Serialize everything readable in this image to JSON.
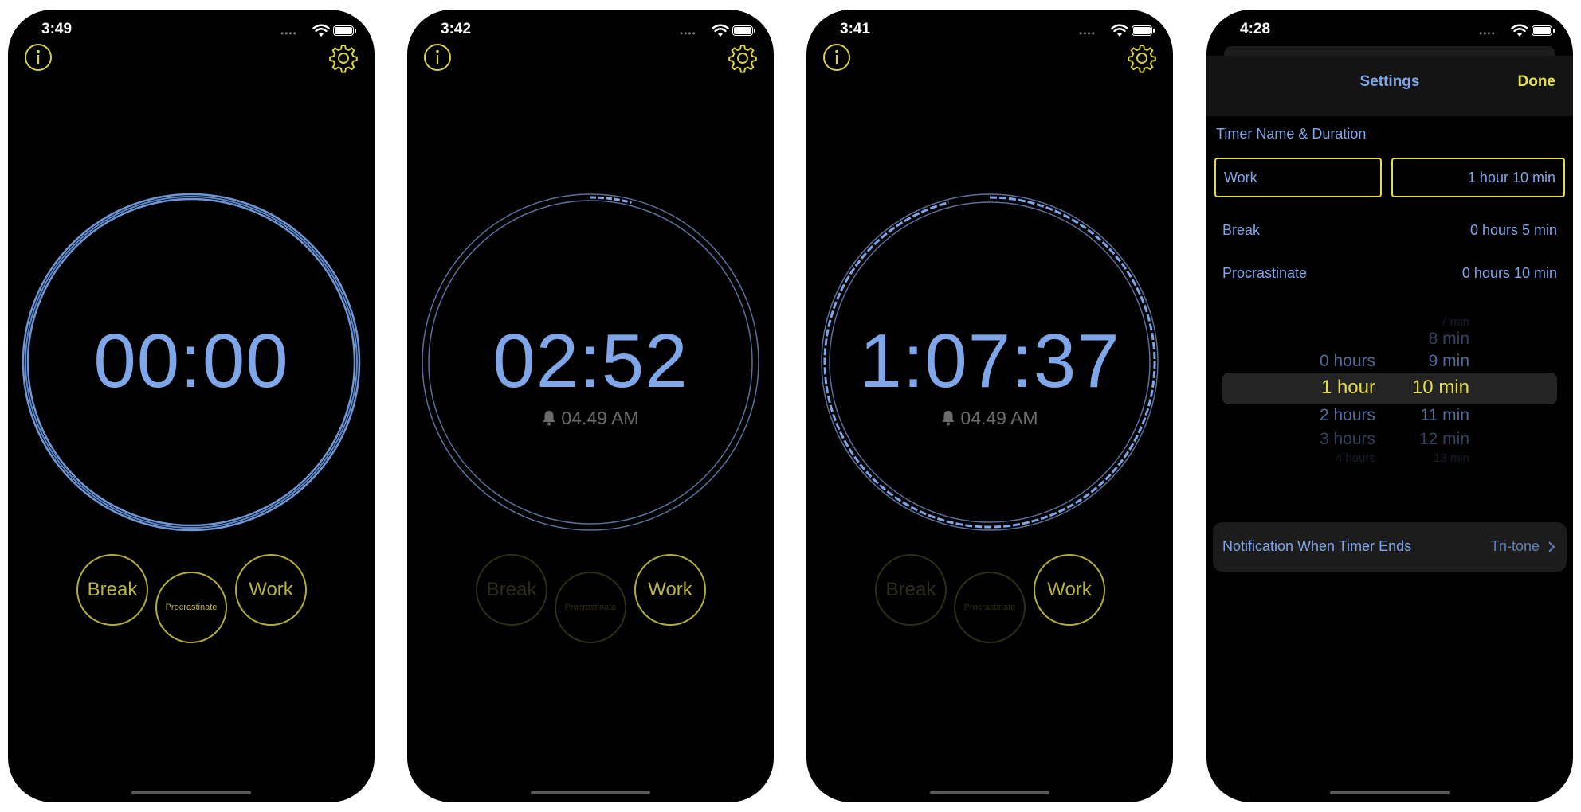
{
  "screens": [
    {
      "status_time": "3:49",
      "timer": "00:00",
      "alarm": "",
      "progress": 0,
      "buttons": {
        "break": "Break",
        "procrastinate": "Procrastinate",
        "work": "Work"
      },
      "button_states": {
        "break": "active",
        "procrastinate": "active",
        "work": "active"
      }
    },
    {
      "status_time": "3:42",
      "timer": "02:52",
      "alarm": "04.49 AM",
      "progress": 0.04,
      "buttons": {
        "break": "Break",
        "procrastinate": "Procrastinate",
        "work": "Work"
      },
      "button_states": {
        "break": "dim",
        "procrastinate": "dim",
        "work": "active"
      }
    },
    {
      "status_time": "3:41",
      "timer": "1:07:37",
      "alarm": "04.49 AM",
      "progress": 0.96,
      "buttons": {
        "break": "Break",
        "procrastinate": "Procrastinate",
        "work": "Work"
      },
      "button_states": {
        "break": "dim",
        "procrastinate": "dim",
        "work": "active"
      }
    }
  ],
  "settings": {
    "status_time": "4:28",
    "title": "Settings",
    "done": "Done",
    "section": "Timer Name & Duration",
    "selected_name": "Work",
    "selected_duration": "1 hour  10 min",
    "timers": [
      {
        "name": "Break",
        "duration": "0 hours  5 min"
      },
      {
        "name": "Procrastinate",
        "duration": "0 hours  10 min"
      }
    ],
    "picker": {
      "hours": [
        "0 hours",
        "1 hour",
        "2 hours",
        "3 hours",
        "4 hours"
      ],
      "minutes": [
        "7 min",
        "8 min",
        "9 min",
        "10 min",
        "11 min",
        "12 min",
        "13 min"
      ],
      "selected_hours": "1 hour",
      "selected_minutes": "10 min"
    },
    "notification_label": "Notification When Timer Ends",
    "notification_value": "Tri-tone"
  },
  "colors": {
    "accent_blue": "#7fa6e8",
    "accent_yellow": "#e3de4a",
    "background": "#000000"
  }
}
